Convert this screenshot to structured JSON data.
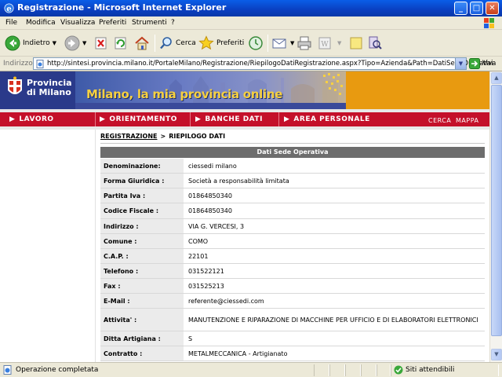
{
  "window": {
    "title": "Registrazione - Microsoft Internet Explorer",
    "min_label": "_",
    "max_label": "□",
    "close_label": "✕"
  },
  "menu": [
    "File",
    "Modifica",
    "Visualizza",
    "Preferiti",
    "Strumenti",
    "?"
  ],
  "toolbar": {
    "back_label": "Indietro",
    "search_label": "Cerca",
    "favorites_label": "Preferiti"
  },
  "address": {
    "label": "Indirizzo",
    "url": "http://sintesi.provincia.milano.it/PortaleMilano/Registrazione/RiepilogoDatiRegistrazione.aspx?Tipo=Azienda&Path=DatiSedeOperativa",
    "go_label": "Vai"
  },
  "banner": {
    "province_line1": "Provincia",
    "province_line2": "di Milano",
    "slogan": "Milano, la mia provincia online"
  },
  "nav": {
    "items": [
      "LAVORO",
      "ORIENTAMENTO",
      "BANCHE DATI",
      "AREA PERSONALE"
    ],
    "search_label": "CERCA",
    "map_label": "MAPPA"
  },
  "breadcrumb": {
    "parent": "REGISTRAZIONE",
    "separator": ">",
    "current": "RIEPILOGO DATI"
  },
  "section_title": "Dati Sede Operativa",
  "fields": [
    {
      "label": "Denominazione:",
      "value": "ciessedi milano"
    },
    {
      "label": "Forma Giuridica :",
      "value": "Società a responsabilità limitata"
    },
    {
      "label": "Partita Iva :",
      "value": "01864850340"
    },
    {
      "label": "Codice Fiscale :",
      "value": "01864850340"
    },
    {
      "label": "Indirizzo :",
      "value": "VIA G. VERCESI, 3"
    },
    {
      "label": "Comune :",
      "value": "COMO"
    },
    {
      "label": "C.A.P. :",
      "value": "22101"
    },
    {
      "label": "Telefono :",
      "value": "031522121"
    },
    {
      "label": "Fax :",
      "value": "031525213"
    },
    {
      "label": "E-Mail :",
      "value": "referente@ciessedi.com"
    },
    {
      "label": "Attivita' :",
      "value": "MANUTENZIONE E RIPARAZIONE DI MACCHINE PER UFFICIO E DI ELABORATORI ELETTRONICI"
    },
    {
      "label": "Ditta Artigiana :",
      "value": "S"
    },
    {
      "label": "Contratto :",
      "value": "METALMECCANICA - Artigianato"
    }
  ],
  "status": {
    "text": "Operazione completata",
    "zone": "Siti attendibili"
  }
}
